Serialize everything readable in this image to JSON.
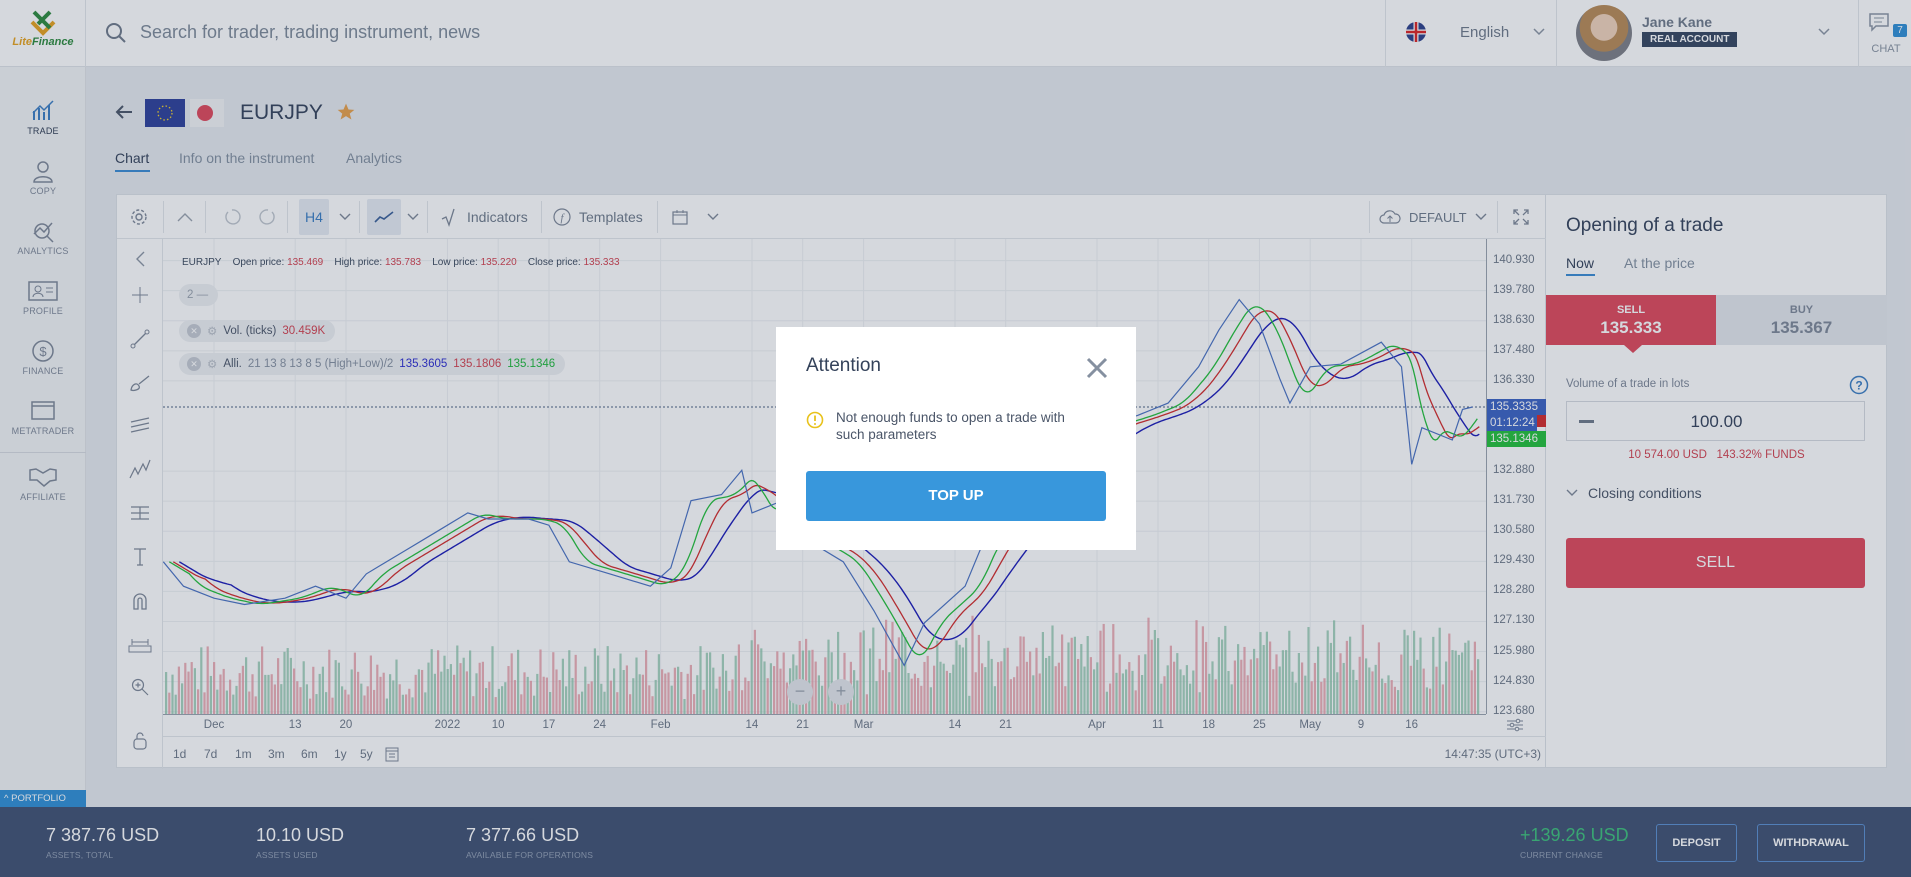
{
  "app": {
    "brand_part1": "Lite",
    "brand_part2": "Finance",
    "logo_icon": "litefinance-logo"
  },
  "search": {
    "placeholder": "Search for trader, trading instrument, news",
    "icon": "search-icon"
  },
  "language": {
    "label": "English",
    "flag": "uk-flag"
  },
  "user": {
    "name": "Jane Kane",
    "account_type": "REAL ACCOUNT"
  },
  "chat": {
    "label": "CHAT",
    "count": "7"
  },
  "sidebar": {
    "items": [
      {
        "label": "TRADE",
        "icon": "trade-chart-icon",
        "active": true
      },
      {
        "label": "COPY",
        "icon": "copy-user-icon"
      },
      {
        "label": "ANALYTICS",
        "icon": "analytics-icon"
      },
      {
        "label": "PROFILE",
        "icon": "profile-card-icon"
      },
      {
        "label": "FINANCE",
        "icon": "dollar-icon"
      },
      {
        "label": "METATRADER",
        "icon": "window-icon"
      },
      {
        "label": "AFFILIATE",
        "icon": "handshake-icon"
      }
    ]
  },
  "instrument": {
    "symbol": "EURJPY",
    "favorite": true,
    "tabs": [
      {
        "label": "Chart",
        "active": true
      },
      {
        "label": "Info on the instrument"
      },
      {
        "label": "Analytics"
      }
    ]
  },
  "chart_toolbar": {
    "interval": "H4",
    "indicators_label": "Indicators",
    "templates_label": "Templates",
    "layout_label": "DEFAULT"
  },
  "chart_legend": {
    "symbol": "EURJPY",
    "open_label": "Open price:",
    "open": "135.469",
    "high_label": "High price:",
    "high": "135.783",
    "low_label": "Low price:",
    "low": "135.220",
    "close_label": "Close price:",
    "close": "135.333",
    "collapsed_count": "2 —",
    "volume_name": "Vol. (ticks)",
    "volume_value": "30.459K",
    "alligator_name": "Alli.",
    "alligator_params": "21 13 8 13 8 5 (High+Low)/2",
    "alligator_jaw": "135.3605",
    "alligator_teeth": "135.1806",
    "alligator_lips": "135.1346"
  },
  "chart_data": {
    "type": "line",
    "symbol": "EURJPY",
    "interval": "H4",
    "y_ticks": [
      "140.930",
      "139.780",
      "138.630",
      "137.480",
      "136.330",
      "132.880",
      "131.730",
      "130.580",
      "129.430",
      "128.280",
      "127.130",
      "125.980",
      "124.830",
      "123.680"
    ],
    "ylim": [
      123.68,
      140.93
    ],
    "x_ticks": [
      {
        "label": "Dec",
        "date": "2021-12-01"
      },
      {
        "label": "13",
        "date": "2021-12-13"
      },
      {
        "label": "20",
        "date": "2021-12-20"
      },
      {
        "label": "2022",
        "date": "2022-01-03"
      },
      {
        "label": "10",
        "date": "2022-01-10"
      },
      {
        "label": "17",
        "date": "2022-01-17"
      },
      {
        "label": "24",
        "date": "2022-01-24"
      },
      {
        "label": "Feb",
        "date": "2022-02-01"
      },
      {
        "label": "14",
        "date": "2022-02-14"
      },
      {
        "label": "21",
        "date": "2022-02-21"
      },
      {
        "label": "Mar",
        "date": "2022-03-01"
      },
      {
        "label": "14",
        "date": "2022-03-14"
      },
      {
        "label": "21",
        "date": "2022-03-21"
      },
      {
        "label": "Apr",
        "date": "2022-04-01"
      },
      {
        "label": "11",
        "date": "2022-04-11"
      },
      {
        "label": "18",
        "date": "2022-04-18"
      },
      {
        "label": "25",
        "date": "2022-04-25"
      },
      {
        "label": "May",
        "date": "2022-05-02"
      },
      {
        "label": "9",
        "date": "2022-05-09"
      },
      {
        "label": "16",
        "date": "2022-05-16"
      }
    ],
    "price_series": [
      [
        "2021-11-24",
        129.41
      ],
      [
        "2021-11-26",
        128.48
      ],
      [
        "2021-12-01",
        128.02
      ],
      [
        "2021-12-06",
        127.78
      ],
      [
        "2021-12-10",
        128.02
      ],
      [
        "2021-12-15",
        128.48
      ],
      [
        "2021-12-20",
        128.02
      ],
      [
        "2021-12-22",
        128.95
      ],
      [
        "2021-12-28",
        129.88
      ],
      [
        "2021-12-31",
        130.58
      ],
      [
        "2022-01-05",
        131.28
      ],
      [
        "2022-01-07",
        131.05
      ],
      [
        "2022-01-13",
        131.05
      ],
      [
        "2022-01-17",
        130.81
      ],
      [
        "2022-01-19",
        129.41
      ],
      [
        "2022-01-25",
        128.95
      ],
      [
        "2022-01-31",
        128.48
      ],
      [
        "2022-02-02",
        129.18
      ],
      [
        "2022-02-04",
        131.75
      ],
      [
        "2022-02-09",
        131.98
      ],
      [
        "2022-02-11",
        132.91
      ],
      [
        "2022-02-14",
        131.28
      ],
      [
        "2022-02-17",
        131.75
      ],
      [
        "2022-02-21",
        130.35
      ],
      [
        "2022-02-25",
        129.41
      ],
      [
        "2022-03-02",
        127.55
      ],
      [
        "2022-03-07",
        125.45
      ],
      [
        "2022-03-09",
        127.08
      ],
      [
        "2022-03-15",
        128.48
      ],
      [
        "2022-03-17",
        130.35
      ],
      [
        "2022-03-23",
        131.28
      ],
      [
        "2022-03-28",
        133.14
      ],
      [
        "2022-04-01",
        134.54
      ],
      [
        "2022-04-07",
        135.01
      ],
      [
        "2022-04-12",
        135.48
      ],
      [
        "2022-04-15",
        136.87
      ],
      [
        "2022-04-19",
        138.27
      ],
      [
        "2022-04-21",
        139.44
      ],
      [
        "2022-04-25",
        138.51
      ],
      [
        "2022-04-27",
        136.41
      ],
      [
        "2022-04-28",
        135.48
      ],
      [
        "2022-05-02",
        136.87
      ],
      [
        "2022-05-05",
        136.97
      ],
      [
        "2022-05-11",
        137.81
      ],
      [
        "2022-05-13",
        136.87
      ],
      [
        "2022-05-16",
        133.14
      ],
      [
        "2022-05-17",
        134.54
      ],
      [
        "2022-05-20",
        134.07
      ],
      [
        "2022-05-23",
        135.24
      ],
      [
        "2022-05-24",
        135.33
      ]
    ],
    "indicators": [
      "Alligator",
      "Volume"
    ],
    "colors": {
      "price": "#4a72c4",
      "jaw": "#1a1ab8",
      "teeth": "#d42a2a",
      "lips": "#22c03a",
      "volume_up": "#8fc7ad",
      "volume_down": "#e89aa4"
    },
    "grid": true
  },
  "price_labels": {
    "current": "135.3335",
    "countdown": "01:12:24",
    "lips": "135.1346"
  },
  "ranges": [
    "1d",
    "7d",
    "1m",
    "3m",
    "6m",
    "1y",
    "5y"
  ],
  "clock": "14:47:35 (UTC+3)",
  "trade": {
    "title": "Opening of a trade",
    "tabs": [
      {
        "label": "Now",
        "active": true
      },
      {
        "label": "At the price"
      }
    ],
    "sell_label": "SELL",
    "sell_price": "135.333",
    "buy_label": "BUY",
    "buy_price": "135.367",
    "volume_label": "Volume of a trade in lots",
    "volume_value": "100.00",
    "margin": "10 574.00 USD",
    "funds": "143.32% FUNDS",
    "closing_label": "Closing conditions",
    "submit_label": "SELL",
    "colors": {
      "sell": "#e0485a",
      "buy_bg": "#e4e8ed"
    }
  },
  "portfolio_tab": "PORTFOLIO",
  "footer": {
    "stats": [
      {
        "value": "7 387.76 USD",
        "label": "ASSETS, TOTAL"
      },
      {
        "value": "10.10 USD",
        "label": "ASSETS USED"
      },
      {
        "value": "7 377.66 USD",
        "label": "AVAILABLE FOR OPERATIONS"
      }
    ],
    "change_value": "+139.26 USD",
    "change_label": "CURRENT CHANGE",
    "deposit_label": "DEPOSIT",
    "withdrawal_label": "WITHDRAWAL"
  },
  "modal": {
    "title": "Attention",
    "message": "Not enough funds to open a trade with such parameters",
    "button_label": "TOP UP",
    "accent": "#3897dc"
  }
}
